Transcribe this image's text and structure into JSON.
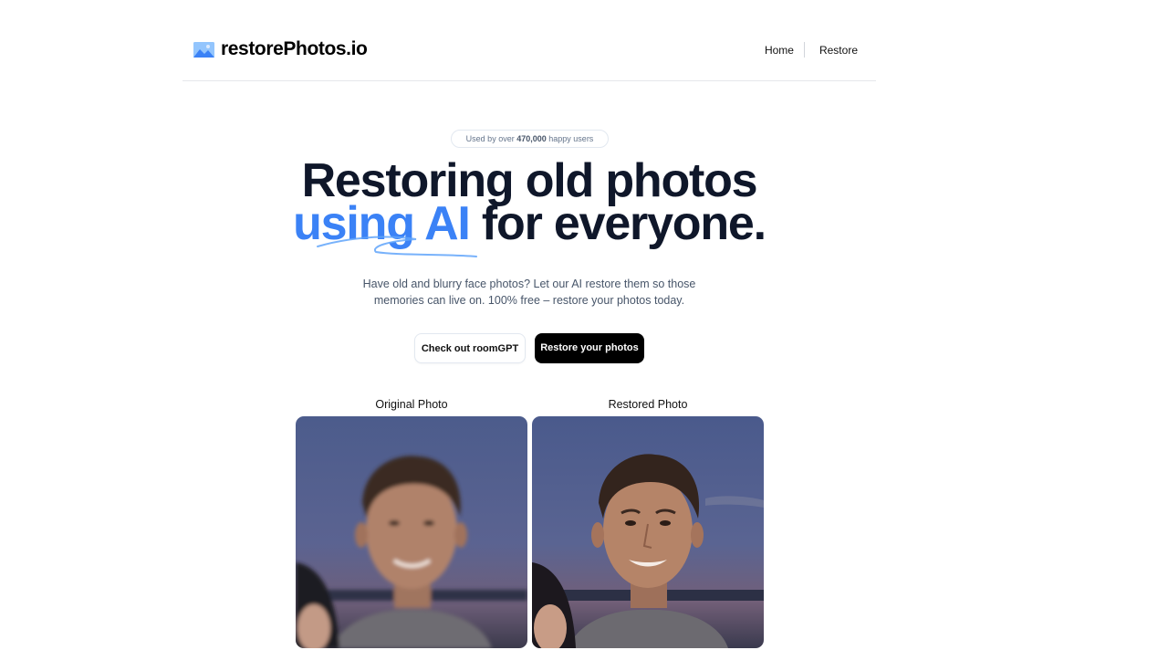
{
  "header": {
    "brand": "restorePhotos.io",
    "logo_icon": "image-icon",
    "nav": {
      "home": "Home",
      "restore": "Restore"
    }
  },
  "hero": {
    "badge_prefix": "Used by over",
    "badge_count": "470,000",
    "badge_suffix": "happy users",
    "title_line1": "Restoring old photos",
    "title_accent": "using AI",
    "title_rest": "for everyone.",
    "description": "Have old and blurry face photos? Let our AI restore them so those memories can live on. 100% free – restore your photos today.",
    "accent_color": "#3b82f6"
  },
  "buttons": {
    "roomgpt": "Check out roomGPT",
    "restore": "Restore your photos"
  },
  "comparison": {
    "original_label": "Original Photo",
    "restored_label": "Restored Photo"
  }
}
